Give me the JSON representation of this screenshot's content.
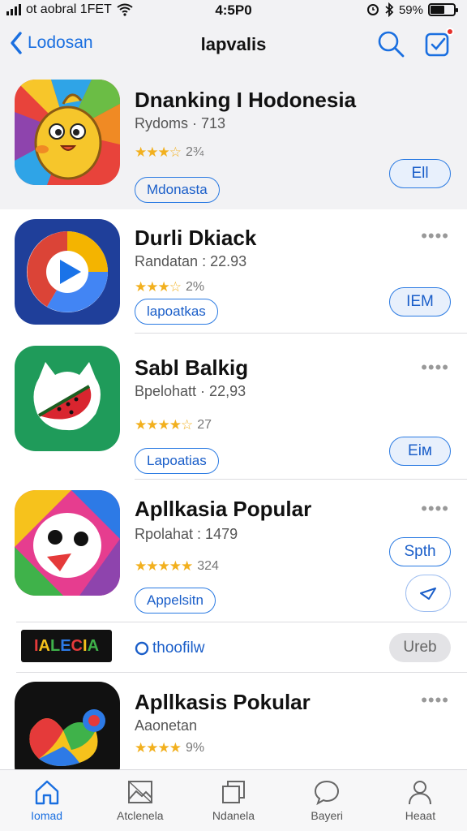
{
  "status_bar": {
    "carrier": "ot aobral 1FET",
    "time": "4:5P0",
    "battery": "59%",
    "battery_level": 0.59
  },
  "nav": {
    "back_label": "Lodosan",
    "title": "lapvalis"
  },
  "apps": [
    {
      "name": "Dnanking I Hodonesia",
      "meta": "Rydoms · 713",
      "stars": "★★★☆",
      "rating": "2¾",
      "tag": "Mdonasta",
      "action": "Ell",
      "icon": "chick-icon"
    },
    {
      "name": "Durli Dkiack",
      "meta": "Randatan : 22.93",
      "stars": "★★★☆",
      "rating": "2%",
      "tag": "lapoatkas",
      "action": "IEM",
      "icon": "play-icon"
    },
    {
      "name": "Sabl Balkig",
      "meta": "Bpelohatt · 22,93",
      "stars": "★★★★☆",
      "rating": "27",
      "tag": "Lapoatias",
      "action": "Eiм",
      "icon": "watermelon-icon"
    },
    {
      "name": "Apllkasia Popular",
      "meta": "Rpolahat : 1479",
      "stars": "★★★★★",
      "rating": "324",
      "tag": "Appelsitn",
      "action": "Spth",
      "icon": "face-icon"
    },
    {
      "name": "Apllkasis Pokular",
      "meta": "Aaonetan",
      "stars": "★★★★",
      "rating": "9%",
      "tag": "",
      "action": "",
      "icon": "swirl-icon"
    }
  ],
  "promo": {
    "logo_text": "IALECIA",
    "link_text": "thoofilw",
    "button": "Ureb"
  },
  "tabs": [
    {
      "label": "Iomad",
      "icon": "home-icon"
    },
    {
      "label": "Atclenela",
      "icon": "picture-icon"
    },
    {
      "label": "Ndanela",
      "icon": "window-icon"
    },
    {
      "label": "Bayeri",
      "icon": "chat-icon"
    },
    {
      "label": "Heaat",
      "icon": "person-icon"
    }
  ],
  "colors": {
    "accent": "#1a6fe0",
    "star": "#f2b01e",
    "badge": "#e5312b"
  }
}
